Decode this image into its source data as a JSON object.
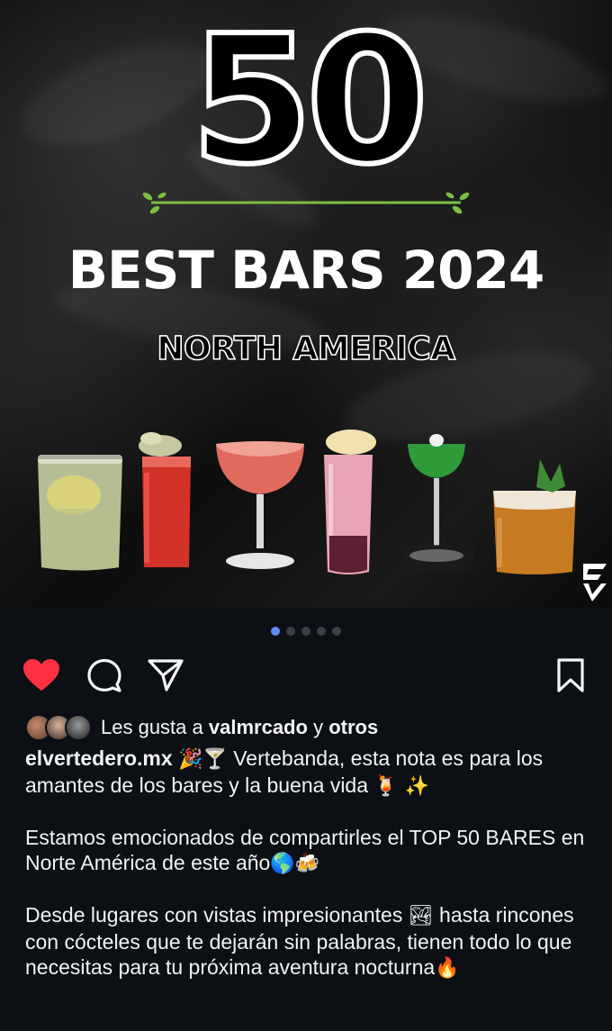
{
  "post": {
    "image": {
      "big_number": "50",
      "headline": "BEST BARS 2024",
      "subline": "NORTH AMERICA",
      "logo_text": "EV",
      "accent_color": "#7bc043"
    },
    "carousel": {
      "total": 5,
      "active": 1
    },
    "actions": {
      "like_icon": "heart-filled-icon",
      "comment_icon": "comment-icon",
      "share_icon": "send-icon",
      "save_icon": "bookmark-icon",
      "liked": true
    },
    "likes": {
      "prefix": "Les gusta a",
      "user": "valmrcado",
      "connector": "y",
      "others": "otros"
    },
    "caption": {
      "username": "elvertedero.mx",
      "p1_emoji": "🎉🍸",
      "p1_text": "Vertebanda, esta nota es para los amantes de los bares y la buena vida",
      "p1_end_emoji": "🍹 ✨",
      "p2_text": "Estamos emocionados de compartirles el TOP 50 BARES en Norte América de este año",
      "p2_end_emoji": "🌎🍻",
      "p3_text_a": "Desde lugares con vistas impresionantes",
      "p3_emoji": "🏞",
      "p3_text_b": "hasta rincones con cócteles que te dejarán sin palabras, tienen todo lo que necesitas para tu próxima aventura nocturna",
      "p3_end_emoji": "🔥"
    }
  }
}
